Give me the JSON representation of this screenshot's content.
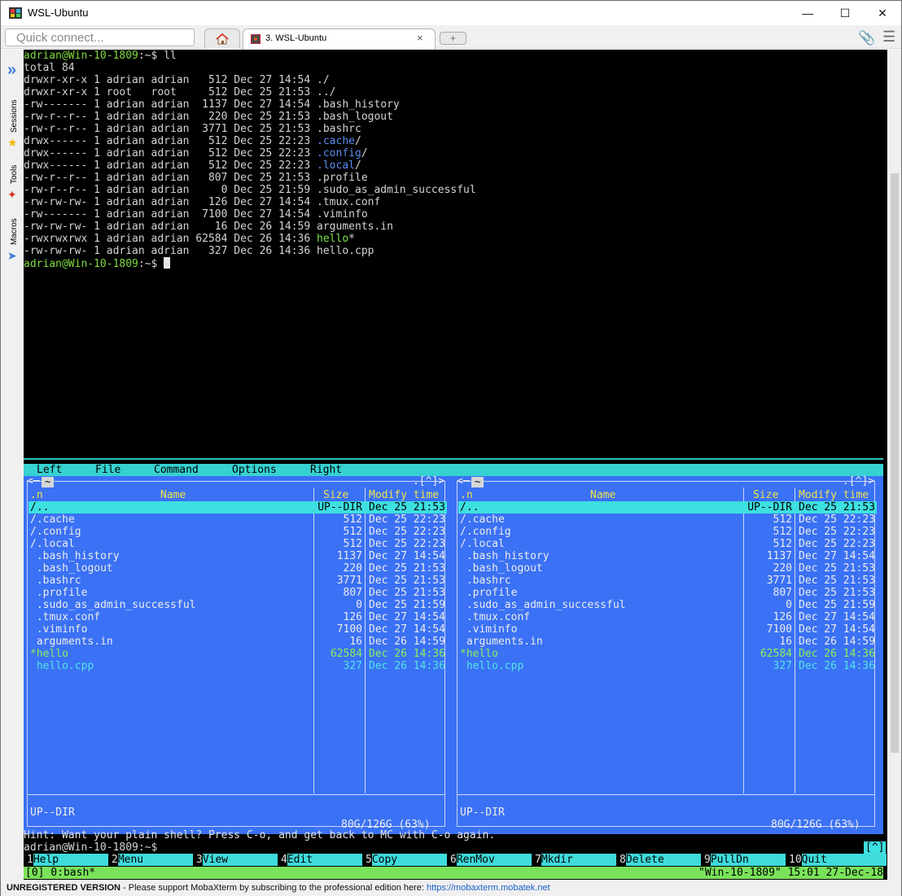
{
  "window": {
    "title": "WSL-Ubuntu",
    "min": "—",
    "max": "☐",
    "close": "✕"
  },
  "toolbar": {
    "quick_connect_placeholder": "Quick connect...",
    "home_icon": "home-icon",
    "tab_label": "3. WSL-Ubuntu",
    "tab_close": "×",
    "new_tab": "+"
  },
  "sidebar": {
    "sessions": "Sessions",
    "tools": "Tools",
    "macros": "Macros"
  },
  "terminal": {
    "prompt_user": "adrian@Win-10-1809",
    "prompt_path": ":~$ ",
    "command": "ll",
    "total": "total 84",
    "listing": [
      {
        "meta": "drwxr-xr-x 1 adrian adrian   512 Dec 27 14:54 ",
        "name": "./",
        "kind": "plain"
      },
      {
        "meta": "drwxr-xr-x 1 root   root     512 Dec 25 21:53 ",
        "name": "../",
        "kind": "plain"
      },
      {
        "meta": "-rw------- 1 adrian adrian  1137 Dec 27 14:54 ",
        "name": ".bash_history",
        "kind": "plain"
      },
      {
        "meta": "-rw-r--r-- 1 adrian adrian   220 Dec 25 21:53 ",
        "name": ".bash_logout",
        "kind": "plain"
      },
      {
        "meta": "-rw-r--r-- 1 adrian adrian  3771 Dec 25 21:53 ",
        "name": ".bashrc",
        "kind": "plain"
      },
      {
        "meta": "drwx------ 1 adrian adrian   512 Dec 25 22:23 ",
        "name": ".cache",
        "suffix": "/",
        "kind": "dir"
      },
      {
        "meta": "drwx------ 1 adrian adrian   512 Dec 25 22:23 ",
        "name": ".config",
        "suffix": "/",
        "kind": "dir"
      },
      {
        "meta": "drwx------ 1 adrian adrian   512 Dec 25 22:23 ",
        "name": ".local",
        "suffix": "/",
        "kind": "dir"
      },
      {
        "meta": "-rw-r--r-- 1 adrian adrian   807 Dec 25 21:53 ",
        "name": ".profile",
        "kind": "plain"
      },
      {
        "meta": "-rw-r--r-- 1 adrian adrian     0 Dec 25 21:59 ",
        "name": ".sudo_as_admin_successful",
        "kind": "plain"
      },
      {
        "meta": "-rw-rw-rw- 1 adrian adrian   126 Dec 27 14:54 ",
        "name": ".tmux.conf",
        "kind": "plain"
      },
      {
        "meta": "-rw------- 1 adrian adrian  7100 Dec 27 14:54 ",
        "name": ".viminfo",
        "kind": "plain"
      },
      {
        "meta": "-rw-rw-rw- 1 adrian adrian    16 Dec 26 14:59 ",
        "name": "arguments.in",
        "kind": "plain"
      },
      {
        "meta": "-rwxrwxrwx 1 adrian adrian 62584 Dec 26 14:36 ",
        "name": "hello",
        "suffix": "*",
        "kind": "exec"
      },
      {
        "meta": "-rw-rw-rw- 1 adrian adrian   327 Dec 26 14:36 ",
        "name": "hello.cpp",
        "kind": "plain"
      }
    ]
  },
  "mc": {
    "menu": [
      "Left",
      "File",
      "Command",
      "Options",
      "Right"
    ],
    "panel_path": "~",
    "corner": ".[^]>",
    "columns": {
      "n": ".n",
      "name": "Name",
      "size": "Size",
      "modify": "Modify time"
    },
    "rows": [
      {
        "name": "/..",
        "size": "UP--DIR",
        "date": "Dec 25 21:53",
        "kind": "dir"
      },
      {
        "name": "/.cache",
        "size": "512",
        "date": "Dec 25 22:23",
        "kind": "dir"
      },
      {
        "name": "/.config",
        "size": "512",
        "date": "Dec 25 22:23",
        "kind": "dir"
      },
      {
        "name": "/.local",
        "size": "512",
        "date": "Dec 25 22:23",
        "kind": "dir"
      },
      {
        "name": " .bash_history",
        "size": "1137",
        "date": "Dec 27 14:54",
        "kind": "file"
      },
      {
        "name": " .bash_logout",
        "size": "220",
        "date": "Dec 25 21:53",
        "kind": "file"
      },
      {
        "name": " .bashrc",
        "size": "3771",
        "date": "Dec 25 21:53",
        "kind": "file"
      },
      {
        "name": " .profile",
        "size": "807",
        "date": "Dec 25 21:53",
        "kind": "file"
      },
      {
        "name": " .sudo_as_admin_successful",
        "size": "0",
        "date": "Dec 25 21:59",
        "kind": "file"
      },
      {
        "name": " .tmux.conf",
        "size": "126",
        "date": "Dec 27 14:54",
        "kind": "file"
      },
      {
        "name": " .viminfo",
        "size": "7100",
        "date": "Dec 27 14:54",
        "kind": "file"
      },
      {
        "name": " arguments.in",
        "size": "16",
        "date": "Dec 26 14:59",
        "kind": "file"
      },
      {
        "name": "*hello",
        "size": "62584",
        "date": "Dec 26 14:36",
        "kind": "exec"
      },
      {
        "name": " hello.cpp",
        "size": "327",
        "date": "Dec 26 14:36",
        "kind": "src"
      }
    ],
    "left_status": "UP--DIR",
    "right_status": "UP--DIR",
    "disk": "80G/126G (63%)",
    "hint": "Hint: Want your plain shell? Press C-o, and get back to MC with C-o again.",
    "prompt": "adrian@Win-10-1809:~$",
    "prompt_corner": "[^]",
    "fkeys": [
      {
        "n": "1",
        "label": "Help"
      },
      {
        "n": "2",
        "label": "Menu"
      },
      {
        "n": "3",
        "label": "View"
      },
      {
        "n": "4",
        "label": "Edit"
      },
      {
        "n": "5",
        "label": "Copy"
      },
      {
        "n": "6",
        "label": "RenMov"
      },
      {
        "n": "7",
        "label": "Mkdir"
      },
      {
        "n": "8",
        "label": "Delete"
      },
      {
        "n": "9",
        "label": "PullDn"
      },
      {
        "n": "10",
        "label": "Quit"
      }
    ]
  },
  "tmux": {
    "left": "[0] 0:bash*",
    "right": "\"Win-10-1809\" 15:01 27-Dec-18"
  },
  "statusbar": {
    "bold": "UNREGISTERED VERSION",
    "text": " -  Please support MobaXterm by subscribing to the professional edition here:  ",
    "link": "https://mobaxterm.mobatek.net"
  },
  "colors": {
    "terminal_bg": "#000000",
    "mc_panel_bg": "#3a71f5",
    "mc_highlight": "#3de0e0",
    "prompt_green": "#7eda3e",
    "dir_blue": "#5c8ef0",
    "tmux_bar": "#7ae25a"
  }
}
